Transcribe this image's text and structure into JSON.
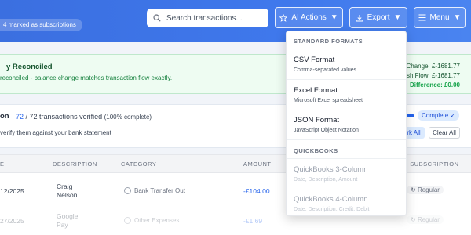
{
  "header": {
    "marked_pill": "4 marked as subscriptions",
    "search_placeholder": "Search transactions...",
    "ai_actions_label": "AI Actions",
    "export_label": "Export",
    "menu_label": "Menu"
  },
  "banner": {
    "title": "y Reconciled",
    "subtitle": "reconciled - balance change matches transaction flow exactly.",
    "change": "Change: £-1681.77",
    "flow": "ash Flow: £-1681.77",
    "difference": "Difference: £0.00"
  },
  "reconcile": {
    "title": "on",
    "verified": "72",
    "total": "/ 72 transactions verified",
    "percent": "(100% complete)",
    "subtitle": "verify them against your bank statement",
    "progress": 1.0,
    "complete_badge": "Complete ✓",
    "mark_all": "rk All",
    "clear_all": "Clear All"
  },
  "table": {
    "headers": {
      "date": "E",
      "description": "DESCRIPTION",
      "category": "CATEGORY",
      "amount": "AMOUNT",
      "subscription": "? SUBSCRIPTION"
    },
    "rows": [
      {
        "date": "12/2025",
        "desc1": "Craig",
        "desc2": "Nelson",
        "category": "Bank Transfer Out",
        "amount": "-£104.00",
        "sub": "Regular"
      },
      {
        "date": "27/2025",
        "desc1": "Google",
        "desc2": "Pay",
        "category": "Other Expenses",
        "amount": "-£1.69",
        "sub": "Regular"
      }
    ]
  },
  "export_menu": {
    "standard_heading": "STANDARD FORMATS",
    "quickbooks_heading": "QUICKBOOKS",
    "items": [
      {
        "title": "CSV Format",
        "subtitle": "Comma-separated values"
      },
      {
        "title": "Excel Format",
        "subtitle": "Microsoft Excel spreadsheet"
      },
      {
        "title": "JSON Format",
        "subtitle": "JavaScript Object Notation"
      },
      {
        "title": "QuickBooks 3-Column",
        "subtitle": "Date, Description, Amount"
      },
      {
        "title": "QuickBooks 4-Column",
        "subtitle": "Date, Description, Credit, Debit"
      }
    ]
  },
  "colors": {
    "header": "#3f78ec",
    "accent": "#2563eb",
    "success": "#16a34a"
  }
}
